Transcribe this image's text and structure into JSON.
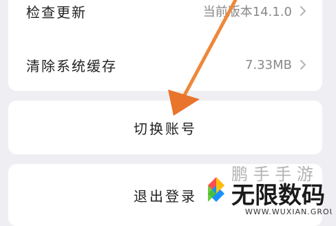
{
  "settings": {
    "check_update": {
      "label": "检查更新",
      "value": "当前版本14.1.0",
      "icon": "chevron-right-icon"
    },
    "clear_cache": {
      "label": "清除系统缓存",
      "value": "7.33MB",
      "icon": "chevron-right-icon"
    },
    "switch_account": {
      "label": "切换账号"
    },
    "logout": {
      "label": "退出登录"
    }
  },
  "watermark": {
    "brand_text": "无限数码",
    "site_text": "WWW.WUXIAN.GROUP"
  },
  "colors": {
    "background": "#efeff3",
    "card": "#ffffff",
    "annotation_arrow": "#f08a3a",
    "watermark_text": "#1a1a1a"
  }
}
